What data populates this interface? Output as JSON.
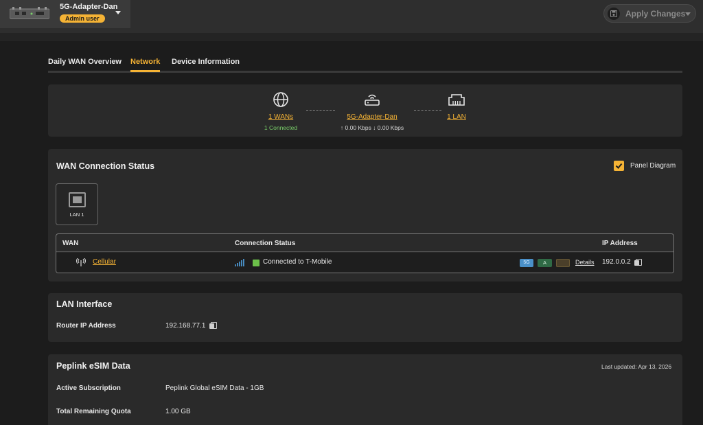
{
  "header": {
    "device_name": "5G-Adapter-Dan",
    "role_badge": "Admin user",
    "apply_label": "Apply Changes"
  },
  "tabs": [
    {
      "label": "Daily WAN Overview",
      "active": false
    },
    {
      "label": "Network",
      "active": true
    },
    {
      "label": "Device Information",
      "active": false
    }
  ],
  "topology": {
    "wans_link": "1 WANs",
    "wans_status": "1 Connected",
    "device_link": "5G-Adapter-Dan",
    "device_throughput": "↑ 0.00 Kbps ↓ 0.00 Kbps",
    "lan_link": "1 LAN"
  },
  "wan_status": {
    "title": "WAN Connection Status",
    "panel_diagram_label": "Panel Diagram",
    "panel_diagram_checked": true,
    "port_label": "LAN 1",
    "columns": {
      "wan": "WAN",
      "status": "Connection Status",
      "ip": "IP Address"
    },
    "rows": [
      {
        "name": "Cellular",
        "status": "Connected to T-Mobile",
        "tech_badge": "5G",
        "sim_badge": "A",
        "details_label": "Details",
        "ip": "192.0.0.2"
      }
    ]
  },
  "lan_interface": {
    "title": "LAN Interface",
    "router_ip_label": "Router IP Address",
    "router_ip_value": "192.168.77.1"
  },
  "esim": {
    "title": "Peplink eSIM Data",
    "last_updated": "Last updated: Apr 13, 2026",
    "subscription_label": "Active Subscription",
    "subscription_value": "Peplink Global eSIM Data - 1GB",
    "quota_label": "Total Remaining Quota",
    "quota_value": "1.00 GB"
  },
  "colors": {
    "accent": "#f5b335",
    "connected_green": "#6cc04a",
    "background": "#1c1c1c",
    "card": "#2a2a2a"
  }
}
